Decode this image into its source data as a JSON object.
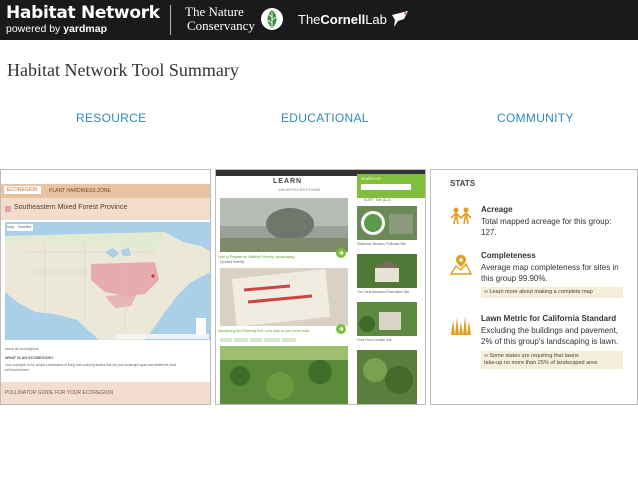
{
  "header": {
    "brand_title": "Habitat Network",
    "brand_powered": "powered by",
    "brand_yardmap": "yardmap",
    "tnc_line1": "The Nature",
    "tnc_line2": "Conservancy",
    "cornell_the": "The",
    "cornell_cornell": "Cornell",
    "cornell_lab": "Lab"
  },
  "page": {
    "title": "Habitat Network Tool Summary"
  },
  "sections": {
    "resource": "RESOURCE",
    "educational": "EDUCATIONAL",
    "community": "COMMUNITY"
  },
  "resource_panel": {
    "tab_ecoregion": "ECOREGION",
    "tab_hardiness": "PLANT HARDINESS ZONE",
    "region_name": "Southeastern Mixed Forest Province",
    "map_btn_map": "Map",
    "map_btn_satellite": "Satellite",
    "show_all": "show all ecoregions",
    "question": "WHAT IS AN ECOREGION?",
    "explain_1": "Your ecoregion is the unique combination of living and nonliving factors that set your landscape apart and determine what",
    "explain_2": "will flourish there.",
    "footer": "POLLINATOR GUIDE FOR YOUR ECOREGION"
  },
  "educational_panel": {
    "learn": "LEARN",
    "count": "105 ARTICLES FOUND",
    "search_label": "SEARCH BY",
    "sort_label": "SORT: Title (A-Z)",
    "caption_1": "How to Prepare for Wildfire-Friendly Landscaping",
    "caption_2": "Introducing the Planning Tool: Let's plan so you never miss",
    "meta_1": "Updated recently",
    "thumb_1": "Wildflower Meadow, Pollinator Site",
    "thumb_2": "The Great Backyard Restoration Site",
    "thumb_3": "Front Porch Garden Site"
  },
  "community_panel": {
    "title": "STATS",
    "acreage_name": "Acreage",
    "acreage_desc_1": "Total mapped acreage for this group:",
    "acreage_desc_2": "127.",
    "completeness_name": "Completeness",
    "completeness_desc_1": "Average map completeness for sites in",
    "completeness_desc_2": "this group 99.90%.",
    "completeness_link": "Learn more about making a complete map",
    "lawn_name": "Lawn Metric for California Standard",
    "lawn_desc_1": "Excluding the buildings and pavement,",
    "lawn_desc_2": "2% of this group's landscaping is lawn.",
    "lawn_link_1": "Some states are requiring that lawns",
    "lawn_link_2": "take-up no more than 25% of landscaped area"
  },
  "colors": {
    "header_bg": "#1a1a1a",
    "section_blue": "#2e8ab8",
    "eco_tab": "#e9c3a2",
    "edu_green": "#7fbf3a",
    "stat_orange": "#e0a020"
  },
  "icons": {
    "tnc_leaf": "leaf-icon",
    "cornell_bird": "bird-icon",
    "acreage": "people-icon",
    "completeness": "map-pin-icon",
    "lawn": "grass-icon"
  }
}
